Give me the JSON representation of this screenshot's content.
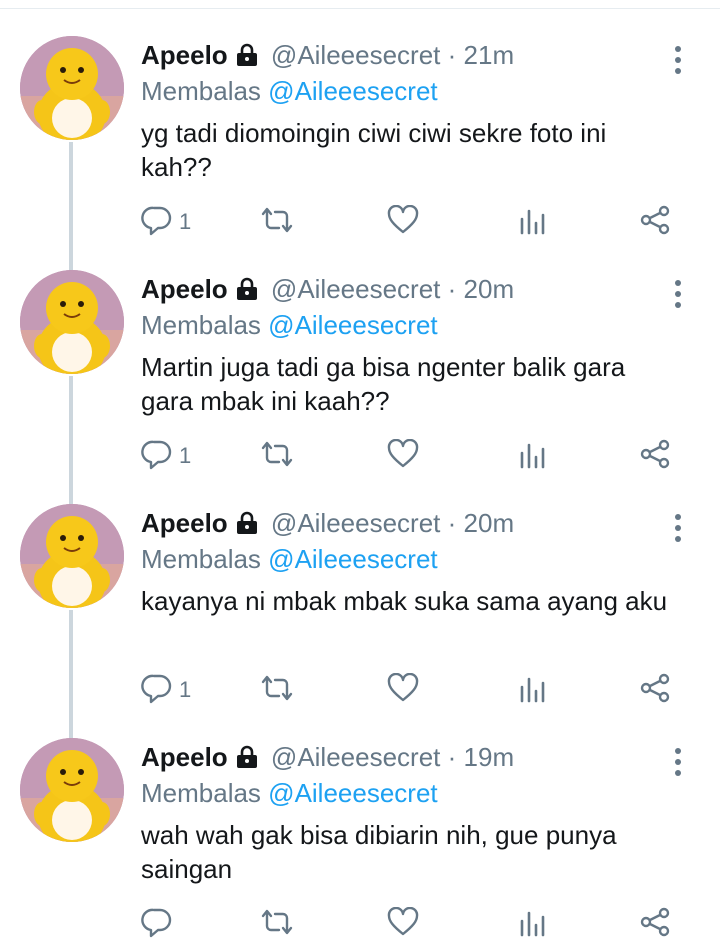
{
  "tweets": [
    {
      "name": "Apeelo",
      "handle": "@Aileeesecret",
      "dot": "·",
      "time": "21m",
      "reply_prefix": "Membalas",
      "reply_to": "@Aileeesecret",
      "text": "yg tadi diomoingin ciwi ciwi sekre foto ini kah??",
      "reply_count": "1"
    },
    {
      "name": "Apeelo",
      "handle": "@Aileeesecret",
      "dot": "·",
      "time": "20m",
      "reply_prefix": "Membalas",
      "reply_to": "@Aileeesecret",
      "text": "Martin juga tadi ga bisa ngenter balik gara gara mbak ini kaah??",
      "reply_count": "1"
    },
    {
      "name": "Apeelo",
      "handle": "@Aileeesecret",
      "dot": "·",
      "time": "20m",
      "reply_prefix": "Membalas",
      "reply_to": "@Aileeesecret",
      "text": "kayanya ni mbak mbak suka sama ayang aku",
      "reply_count": "1"
    },
    {
      "name": "Apeelo",
      "handle": "@Aileeesecret",
      "dot": "·",
      "time": "19m",
      "reply_prefix": "Membalas",
      "reply_to": "@Aileeesecret",
      "text": "wah wah gak bisa dibiarin nih, gue punya saingan",
      "reply_count": ""
    }
  ],
  "icons": {
    "verified_lock": "lock-icon",
    "more": "more-vertical-icon",
    "reply": "reply-icon",
    "retweet": "retweet-icon",
    "like": "heart-icon",
    "stats": "analytics-icon",
    "share": "share-icon"
  },
  "colors": {
    "link": "#1da1f2",
    "secondary_text": "#657786",
    "thread_line": "#ccd6dd",
    "icon": "#657786"
  }
}
